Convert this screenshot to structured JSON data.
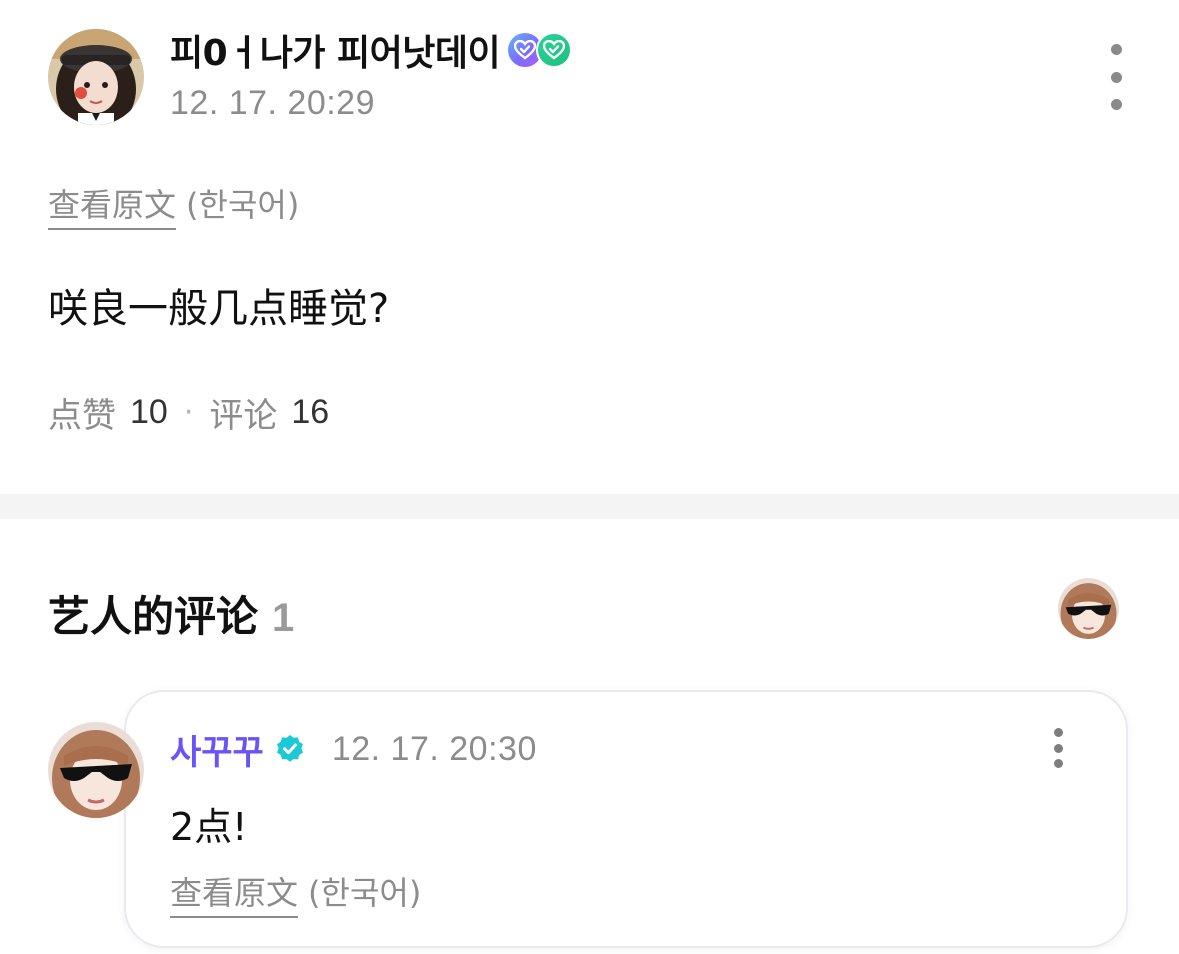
{
  "post": {
    "author": {
      "name": "피0ㅓ나가 피어낫데이",
      "badges": [
        "verified-heart-purple",
        "verified-heart-green"
      ]
    },
    "timestamp": "12. 17. 20:29",
    "translate": {
      "link": "查看原文",
      "language": "(한국어)"
    },
    "body": "咲良一般几点睡觉?",
    "stats": {
      "likes_label": "点赞",
      "likes_value": "10",
      "separator": "·",
      "comments_label": "评论",
      "comments_value": "16"
    }
  },
  "artist_comments": {
    "title": "艺人的评论",
    "count": "1",
    "items": [
      {
        "author": "사꾸꾸",
        "verified": true,
        "timestamp": "12. 17. 20:30",
        "body": "2点!",
        "translate": {
          "link": "查看原文",
          "language": "(한국어)"
        }
      }
    ]
  },
  "colors": {
    "accent_author": "#6b54f5",
    "verified_badge": "#1cc9d6",
    "muted_text": "#8c8c8c",
    "divider_band": "#f4f4f4"
  },
  "icons": {
    "more": "vertical-ellipsis-icon",
    "verified": "verified-check-icon"
  }
}
